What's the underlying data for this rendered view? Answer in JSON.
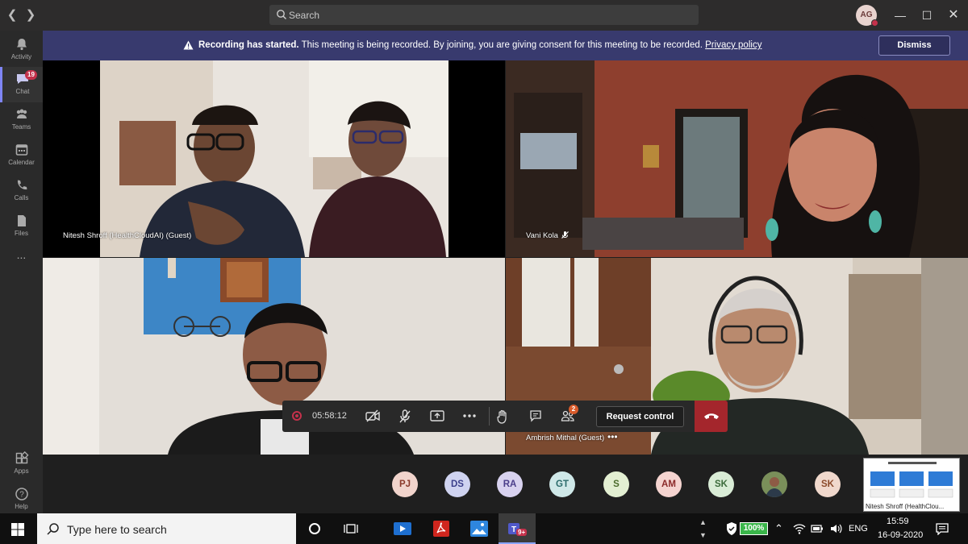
{
  "titlebar": {
    "search_placeholder": "Search",
    "avatar_initials": "AG"
  },
  "rail": {
    "items": [
      {
        "label": "Activity",
        "icon": "bell-icon"
      },
      {
        "label": "Chat",
        "icon": "chat-icon",
        "badge": "19"
      },
      {
        "label": "Teams",
        "icon": "teams-icon"
      },
      {
        "label": "Calendar",
        "icon": "calendar-icon"
      },
      {
        "label": "Calls",
        "icon": "phone-icon"
      },
      {
        "label": "Files",
        "icon": "file-icon"
      },
      {
        "label": "...",
        "icon": "more-icon"
      }
    ],
    "bottom": [
      {
        "label": "Apps",
        "icon": "apps-icon"
      },
      {
        "label": "Help",
        "icon": "help-icon"
      }
    ]
  },
  "banner": {
    "bold": "Recording has started.",
    "text": " This meeting is being recorded. By joining, you are giving consent for this meeting to be recorded. ",
    "link": "Privacy policy",
    "dismiss": "Dismiss"
  },
  "tiles": [
    {
      "name": "Nitesh Shroff (HealthCloudAI) (Guest)"
    },
    {
      "name": "Vani Kola"
    },
    {
      "name": ""
    },
    {
      "name": "Ambrish Mithal (Guest)"
    }
  ],
  "controls": {
    "timer": "05:58:12",
    "participants_badge": "2",
    "request_control": "Request control"
  },
  "participants": [
    {
      "initials": "PJ",
      "bg": "#f1d4cc",
      "fg": "#8b3a2a"
    },
    {
      "initials": "DS",
      "bg": "#cfd3f0",
      "fg": "#3b3f8a"
    },
    {
      "initials": "RA",
      "bg": "#d8d2ef",
      "fg": "#4b3f8a"
    },
    {
      "initials": "GT",
      "bg": "#cfe8e8",
      "fg": "#2b6b6b"
    },
    {
      "initials": "S",
      "bg": "#e3efd2",
      "fg": "#4b6b2b"
    },
    {
      "initials": "AM",
      "bg": "#f5d4d0",
      "fg": "#8b2a2a"
    },
    {
      "initials": "SK",
      "bg": "#d9ecd6",
      "fg": "#3b6b3b"
    },
    {
      "initials": "",
      "bg": "#6f8a55",
      "fg": "#ffffff"
    },
    {
      "initials": "SK",
      "bg": "#f0d8cc",
      "fg": "#8b4a2a"
    }
  ],
  "share_thumb": {
    "caption": "Nitesh Shroff (HealthClou..."
  },
  "taskbar": {
    "search_placeholder": "Type here to search",
    "battery": "100%",
    "lang": "ENG",
    "time": "15:59",
    "date": "16-09-2020",
    "teams_badge": "9+"
  }
}
